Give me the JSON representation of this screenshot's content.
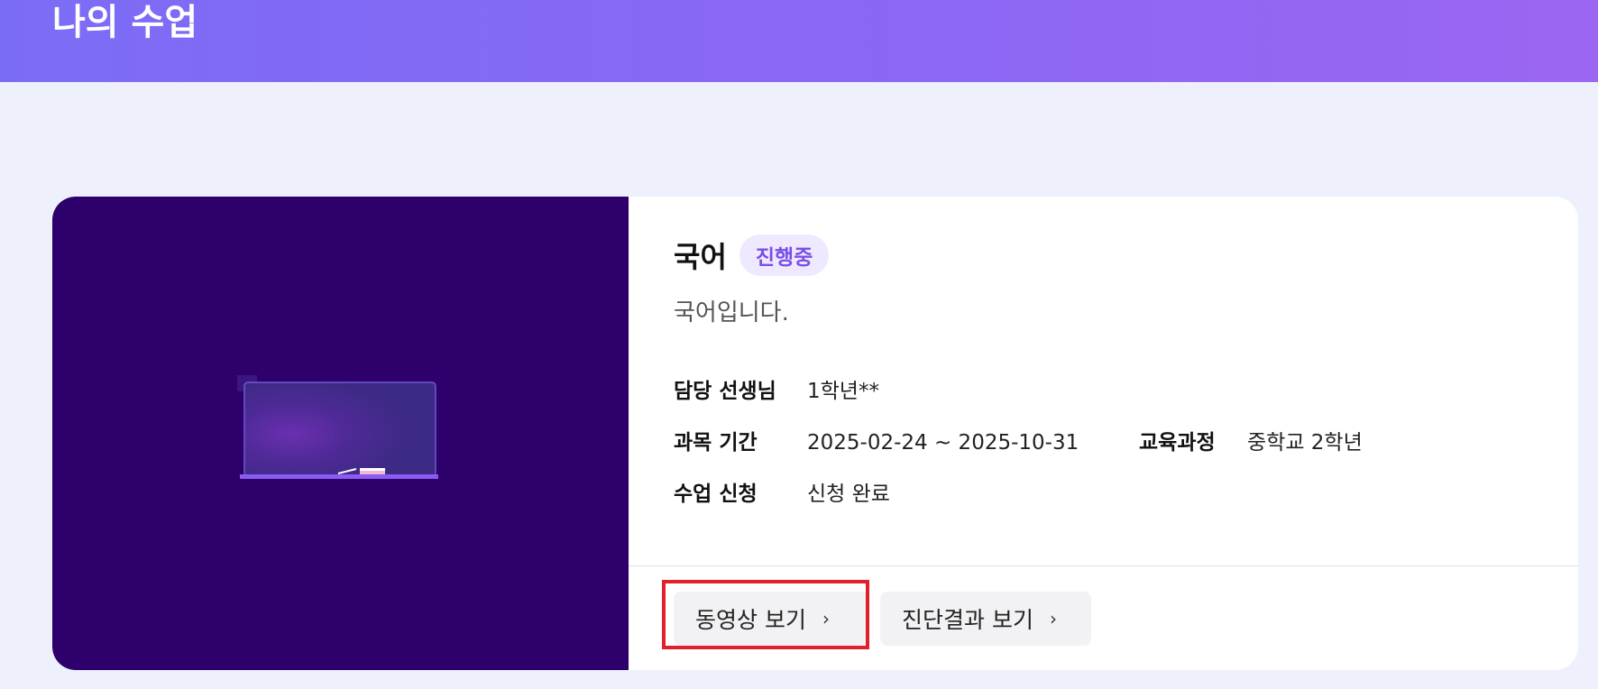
{
  "header": {
    "title": "나의 수업"
  },
  "course": {
    "title": "국어",
    "status": "진행중",
    "description": "국어입니다.",
    "meta": {
      "teacher_label": "담당 선생님",
      "teacher_value": "1학년**",
      "period_label": "과목 기간",
      "period_value": "2025-02-24 ~ 2025-10-31",
      "curriculum_label": "교육과정",
      "curriculum_value": "중학교 2학년",
      "enroll_label": "수업 신청",
      "enroll_value": "신청 완료"
    },
    "buttons": {
      "video_label": "동영상 보기",
      "diagnosis_label": "진단결과 보기"
    }
  },
  "colors": {
    "header_gradient_start": "#7b6cf6",
    "header_gradient_end": "#9b66f2",
    "thumbnail_bg": "#2d006b",
    "badge_text": "#7b4fe6",
    "highlight": "#e0202a"
  }
}
